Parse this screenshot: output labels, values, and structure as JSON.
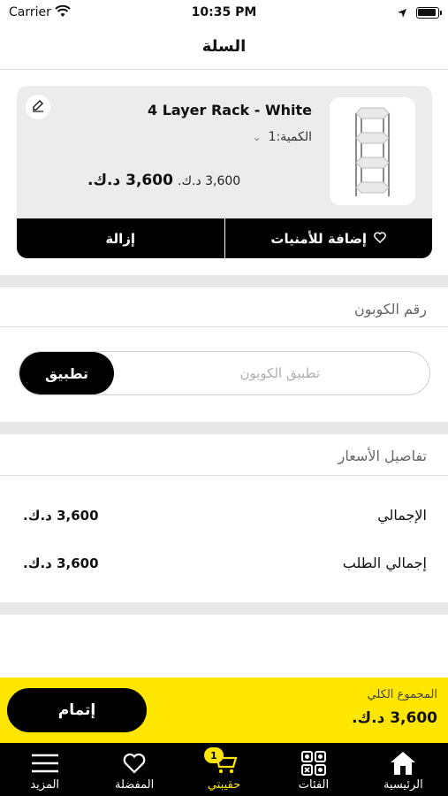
{
  "status": {
    "carrier": "Carrier",
    "time": "10:35 PM"
  },
  "header": {
    "title": "السلة"
  },
  "cart_item": {
    "name": "4 Layer Rack - White",
    "qty_label": "الكمية:1",
    "price_old": "3,600 د.ك.",
    "price_new": "3,600 د.ك.",
    "wishlist_label": "إضافة للأمنيات",
    "remove_label": "إزالة"
  },
  "coupon": {
    "section_title": "رقم الكوبون",
    "placeholder": "تطبيق الكوبون",
    "apply_label": "تطبيق"
  },
  "price_details": {
    "section_title": "تفاصيل الأسعار",
    "rows": [
      {
        "label": "الإجمالي",
        "value": "3,600 د.ك."
      },
      {
        "label": "إجمالي الطلب",
        "value": "3,600 د.ك."
      }
    ]
  },
  "checkout": {
    "total_label": "المجموع الكلي",
    "total_value": "3,600 د.ك.",
    "button_label": "إتمام"
  },
  "tabbar": {
    "cart_badge": "1",
    "items": [
      {
        "label": "الرئيسية",
        "icon": "home-icon"
      },
      {
        "label": "الفئات",
        "icon": "categories-icon"
      },
      {
        "label": "حقيبتي",
        "icon": "cart-icon",
        "active": true
      },
      {
        "label": "المفضلة",
        "icon": "heart-icon"
      },
      {
        "label": "المزيد",
        "icon": "menu-icon"
      }
    ]
  },
  "colors": {
    "accent": "#ffe600",
    "dark": "#000000",
    "card_bg": "#ececec"
  }
}
